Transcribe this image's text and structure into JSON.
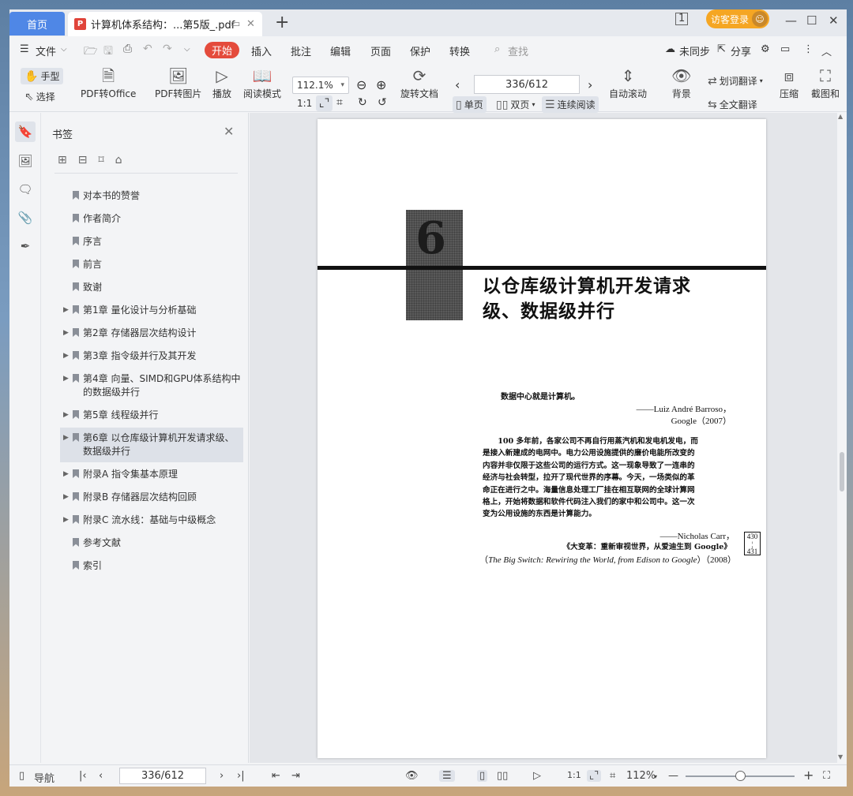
{
  "tabs": {
    "home": "首页",
    "document": "计算机体系结构：...第5版_.pdf",
    "new_tab": "+"
  },
  "title_right": {
    "visitor": "访客登录"
  },
  "menu": {
    "file": "文件",
    "items": [
      "开始",
      "插入",
      "批注",
      "编辑",
      "页面",
      "保护",
      "转换"
    ],
    "search_placeholder": "查找",
    "unsync": "未同步",
    "share": "分享"
  },
  "toolbar": {
    "hand": "手型",
    "select": "选择",
    "pdf_office": "PDF转Office",
    "pdf_image": "PDF转图片",
    "play": "播放",
    "read_mode": "阅读模式",
    "zoom": "112.1%",
    "rotate_doc": "旋转文档",
    "page_indicator": "336/612",
    "single_page": "单页",
    "double_page": "双页",
    "continuous": "连续阅读",
    "auto_scroll": "自动滚动",
    "background": "背景",
    "word_translate": "划词翻译",
    "full_translate": "全文翻译",
    "compress": "压缩",
    "screenshot": "截图和"
  },
  "bookmarks": {
    "title": "书签",
    "items": [
      {
        "label": "对本书的赞誉",
        "expandable": false
      },
      {
        "label": "作者简介",
        "expandable": false
      },
      {
        "label": "序言",
        "expandable": false
      },
      {
        "label": "前言",
        "expandable": false
      },
      {
        "label": "致谢",
        "expandable": false
      },
      {
        "label": "第1章 量化设计与分析基础",
        "expandable": true
      },
      {
        "label": "第2章 存储器层次结构设计",
        "expandable": true
      },
      {
        "label": "第3章 指令级并行及其开发",
        "expandable": true
      },
      {
        "label": "第4章 向量、SIMD和GPU体系结构中的数据级并行",
        "expandable": true
      },
      {
        "label": "第5章 线程级并行",
        "expandable": true
      },
      {
        "label": "第6章 以仓库级计算机开发请求级、数据级并行",
        "expandable": true,
        "selected": true
      },
      {
        "label": "附录A 指令集基本原理",
        "expandable": true
      },
      {
        "label": "附录B 存储器层次结构回顾",
        "expandable": true
      },
      {
        "label": "附录C 流水线：基础与中级概念",
        "expandable": true
      },
      {
        "label": "参考文献",
        "expandable": false
      },
      {
        "label": "索引",
        "expandable": false
      }
    ]
  },
  "page_content": {
    "chapter_number": "6",
    "chapter_title_line1": "以仓库级计算机开发请求",
    "chapter_title_line2": "级、数据级并行",
    "quote1": "数据中心就是计算机。",
    "quote1_author": "——Luiz André Barroso，",
    "quote1_source": "Google（2007）",
    "quote2_lines": [
      "100 多年前，各家公司不再自行用蒸汽机和发电机发电，而",
      "是接入新建成的电网中。电力公用设施提供的廉价电能所改变的",
      "内容并非仅限于这些公司的运行方式。这一现象导致了一连串的",
      "经济与社会转型，拉开了现代世界的序幕。今天，一场类似的革",
      "命正在进行之中。海量信息处理工厂挂在相互联网的全球计算网",
      "格上，开始将数据和软件代码注入我们的家中和公司中。这一次",
      "变为公用设施的东西是计算能力。"
    ],
    "quote2_author": "——Nicholas Carr，",
    "quote2_book_cn": "《大变革：重新审视世界，从爱迪生到 Google》",
    "quote2_book_en": "The Big Switch: Rewiring the World, from Edison to Google",
    "quote2_year": "（2008）",
    "page_ref_top": "430",
    "page_ref_bottom": "431"
  },
  "statusbar": {
    "nav": "导航",
    "page": "336/612",
    "zoom": "112%"
  },
  "colors": {
    "accent": "#4f87e6",
    "start_tab": "#e44b3c",
    "visitor": "#f5a623"
  }
}
